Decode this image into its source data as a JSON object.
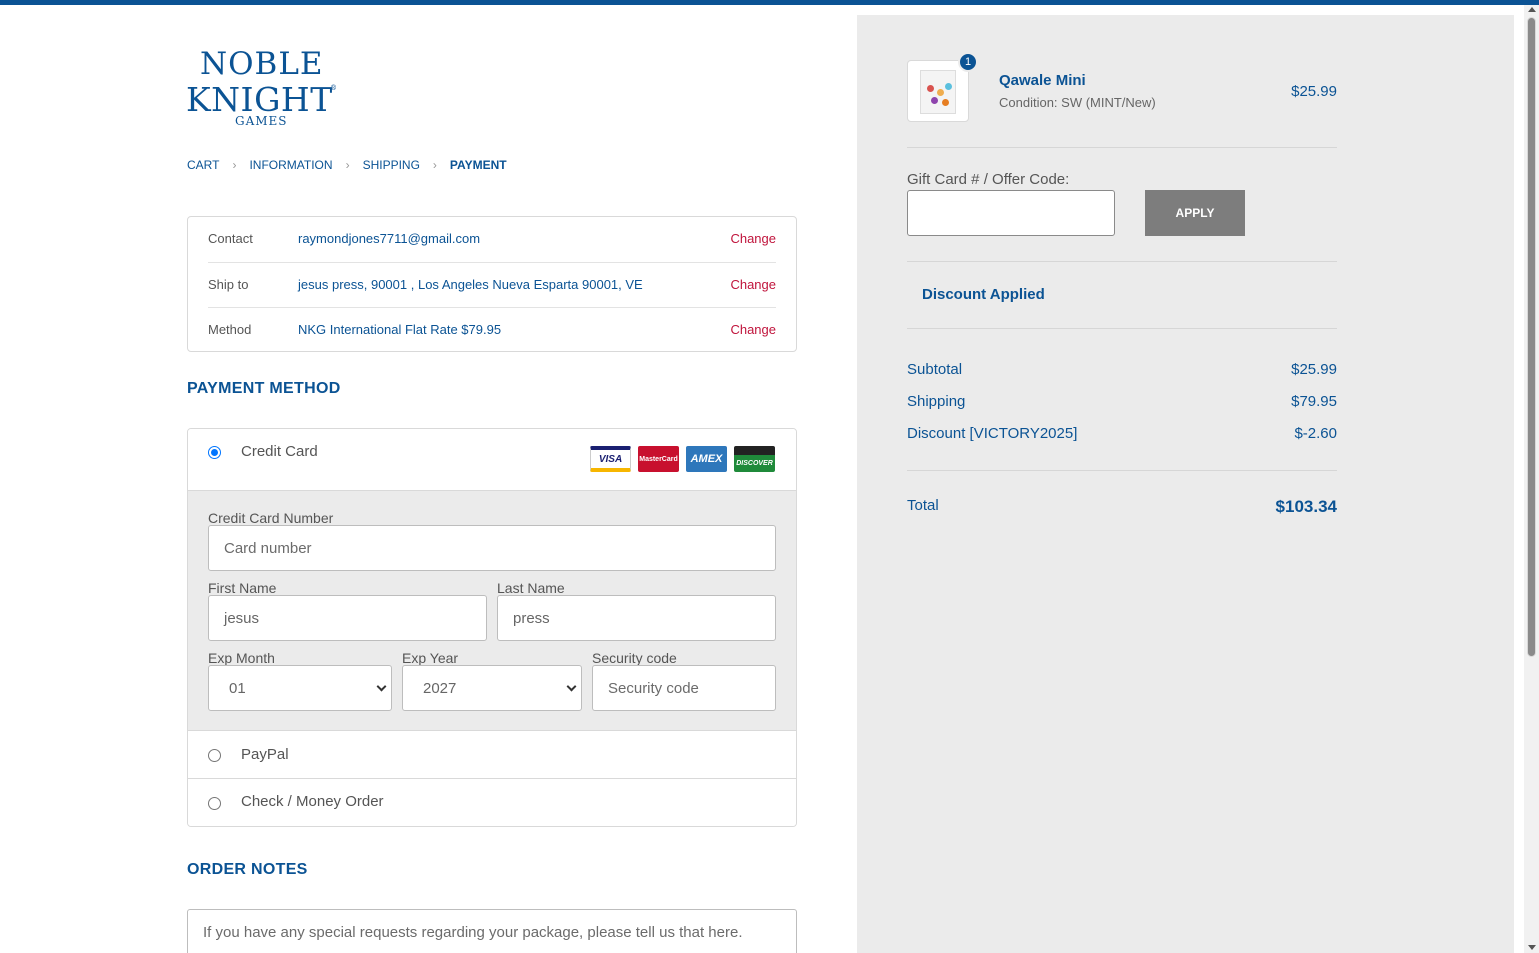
{
  "brand": {
    "logo_line1": "NOBLE",
    "logo_line2": "KNIGHT",
    "logo_line3": "GAMES",
    "logo_reg": "®",
    "accent_color": "#0b5394",
    "change_color": "#c0143c"
  },
  "breadcrumb": {
    "items": [
      "CART",
      "INFORMATION",
      "SHIPPING",
      "PAYMENT"
    ],
    "separator": "›",
    "current": "PAYMENT"
  },
  "review": {
    "rows": [
      {
        "label": "Contact",
        "value": "raymondjones7711@gmail.com",
        "action": "Change"
      },
      {
        "label": "Ship to",
        "value": "jesus press, 90001 , Los Angeles Nueva Esparta 90001, VE",
        "action": "Change"
      },
      {
        "label": "Method",
        "value": "NKG International Flat Rate $79.95",
        "action": "Change"
      }
    ]
  },
  "payment": {
    "title": "PAYMENT METHOD",
    "credit_card_label": "Credit Card",
    "card_logos": [
      "VISA",
      "MasterCard",
      "AMEX",
      "DISCOVER"
    ],
    "selected": "Credit Card",
    "fields": {
      "card_number_label": "Credit Card Number",
      "card_number_placeholder": "Card number",
      "first_name_label": "First Name",
      "first_name_value": "jesus",
      "last_name_label": "Last Name",
      "last_name_value": "press",
      "exp_month_label": "Exp Month",
      "exp_month_value": "01",
      "exp_year_label": "Exp Year",
      "exp_year_value": "2027",
      "security_label": "Security code",
      "security_placeholder": "Security code"
    },
    "paypal_label": "PayPal",
    "check_label": "Check / Money Order"
  },
  "notes": {
    "title": "ORDER NOTES",
    "placeholder": "If you have any special requests regarding your package, please tell us that here."
  },
  "summary": {
    "product": {
      "name": "Qawale Mini",
      "condition": "Condition: SW (MINT/New)",
      "price": "$25.99",
      "quantity": "1"
    },
    "gift_label": "Gift Card # / Offer Code:",
    "apply_label": "APPLY",
    "discount_applied": "Discount Applied",
    "subtotal_label": "Subtotal",
    "subtotal_value": "$25.99",
    "shipping_label": "Shipping",
    "shipping_value": "$79.95",
    "discount_label": "Discount [VICTORY2025]",
    "discount_value": "$-2.60",
    "total_label": "Total",
    "total_value": "$103.34"
  }
}
